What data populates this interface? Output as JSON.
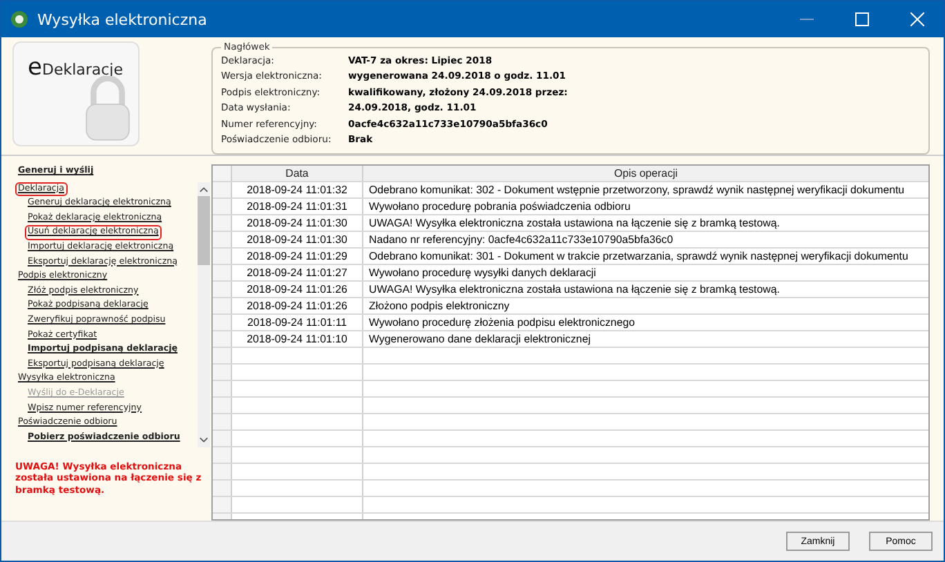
{
  "window": {
    "title": "Wysyłka elektroniczna"
  },
  "logo": {
    "text_e": "e",
    "text": "Deklaracje"
  },
  "header": {
    "legend": "Nagłówek",
    "fields": [
      {
        "label": "Deklaracja:",
        "value": "VAT-7 za okres: Lipiec 2018"
      },
      {
        "label": "Wersja elektroniczna:",
        "value": "wygenerowana 24.09.2018 o godz. 11.01"
      },
      {
        "label": "Podpis elektroniczny:",
        "value": "kwalifikowany, złożony 24.09.2018 przez:"
      },
      {
        "label": "Data wysłania:",
        "value": "24.09.2018, godz. 11.01"
      },
      {
        "label": "Numer referencyjny:",
        "value": "0acfe4c632a11c733e10790a5bfa36c0"
      },
      {
        "label": "Poświadczenie odbioru:",
        "value": "Brak"
      }
    ]
  },
  "sidebar": {
    "title": "Generuj i wyślij",
    "sections": [
      {
        "label": "Deklaracja",
        "marked": true,
        "children": [
          {
            "label": "Generuj deklarację elektroniczną",
            "marked": false,
            "disabled": false,
            "bold": false
          },
          {
            "label": "Pokaż deklarację elektroniczną",
            "marked": false,
            "disabled": false,
            "bold": false
          },
          {
            "label": "Usuń deklarację elektroniczną",
            "marked": true,
            "disabled": false,
            "bold": false
          },
          {
            "label": "Importuj deklarację elektroniczną",
            "marked": false,
            "disabled": false,
            "bold": false
          },
          {
            "label": "Eksportuj deklarację elektroniczną",
            "marked": false,
            "disabled": false,
            "bold": false
          }
        ]
      },
      {
        "label": "Podpis elektroniczny",
        "marked": false,
        "children": [
          {
            "label": "Złóż podpis elektroniczny",
            "marked": false,
            "disabled": false,
            "bold": false
          },
          {
            "label": "Pokaż podpisaną deklarację",
            "marked": false,
            "disabled": false,
            "bold": false
          },
          {
            "label": "Zweryfikuj poprawność podpisu",
            "marked": false,
            "disabled": false,
            "bold": false
          },
          {
            "label": "Pokaż certyfikat",
            "marked": false,
            "disabled": false,
            "bold": false
          },
          {
            "label": "Importuj podpisaną deklarację",
            "marked": false,
            "disabled": false,
            "bold": true
          },
          {
            "label": "Eksportuj podpisaną deklarację",
            "marked": false,
            "disabled": false,
            "bold": false
          }
        ]
      },
      {
        "label": "Wysyłka elektroniczna",
        "marked": false,
        "children": [
          {
            "label": "Wyślij do e-Deklaracje",
            "marked": false,
            "disabled": true,
            "bold": false
          },
          {
            "label": "Wpisz numer referencyjny",
            "marked": false,
            "disabled": false,
            "bold": false
          }
        ]
      },
      {
        "label": "Poświadczenie odbioru",
        "marked": false,
        "children": [
          {
            "label": "Pobierz poświadczenie odbioru",
            "marked": false,
            "disabled": false,
            "bold": true
          }
        ]
      }
    ],
    "warning": "UWAGA! Wysyłka elektroniczna została ustawiona na łączenie się z bramką testową."
  },
  "table": {
    "columns": [
      "Data",
      "Opis operacji"
    ],
    "rows": [
      [
        "2018-09-24 11:01:32",
        "Odebrano komunikat: 302 - Dokument wstępnie przetworzony, sprawdź wynik następnej weryfikacji dokumentu"
      ],
      [
        "2018-09-24 11:01:31",
        "Wywołano procedurę pobrania poświadczenia odbioru"
      ],
      [
        "2018-09-24 11:01:30",
        "UWAGA! Wysyłka elektroniczna została ustawiona na łączenie się z bramką testową."
      ],
      [
        "2018-09-24 11:01:30",
        "Nadano nr referencyjny: 0acfe4c632a11c733e10790a5bfa36c0"
      ],
      [
        "2018-09-24 11:01:29",
        "Odebrano komunikat: 301 - Dokument w trakcie przetwarzania, sprawdź wynik następnej weryfikacji dokumentu"
      ],
      [
        "2018-09-24 11:01:27",
        "Wywołano procedurę wysyłki danych deklaracji"
      ],
      [
        "2018-09-24 11:01:26",
        "UWAGA! Wysyłka elektroniczna została ustawiona na łączenie się z bramką testową."
      ],
      [
        "2018-09-24 11:01:26",
        "Złożono podpis elektroniczny"
      ],
      [
        "2018-09-24 11:01:11",
        "Wywołano procedurę złożenia podpisu elektronicznego"
      ],
      [
        "2018-09-24 11:01:10",
        "Wygenerowano dane deklaracji elektronicznej"
      ]
    ]
  },
  "buttons": [
    "Zamknij",
    "Pomoc"
  ]
}
